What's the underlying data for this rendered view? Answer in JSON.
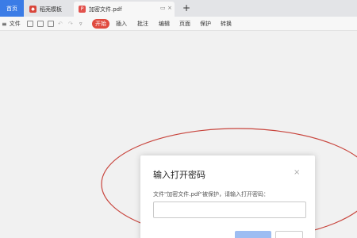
{
  "tabs": {
    "home_label": "首页",
    "template_label": "稻壳模板",
    "pdf_label": "加密文件.pdf",
    "add_label": "+"
  },
  "toolbar": {
    "file_label": "文件",
    "start_label": "开始",
    "insert_label": "插入",
    "annotate_label": "批注",
    "edit_label": "编辑",
    "page_label": "页面",
    "protect_label": "保护",
    "convert_label": "转换"
  },
  "dialog": {
    "title": "输入打开密码",
    "message": "文件\"加密文件.pdf\"被保护，请输入打开密码：",
    "password_value": "",
    "close_label": "×"
  },
  "colors": {
    "accent": "#3b7ce6",
    "start_pill": "#e04a3f",
    "annotation": "#c8443c"
  }
}
